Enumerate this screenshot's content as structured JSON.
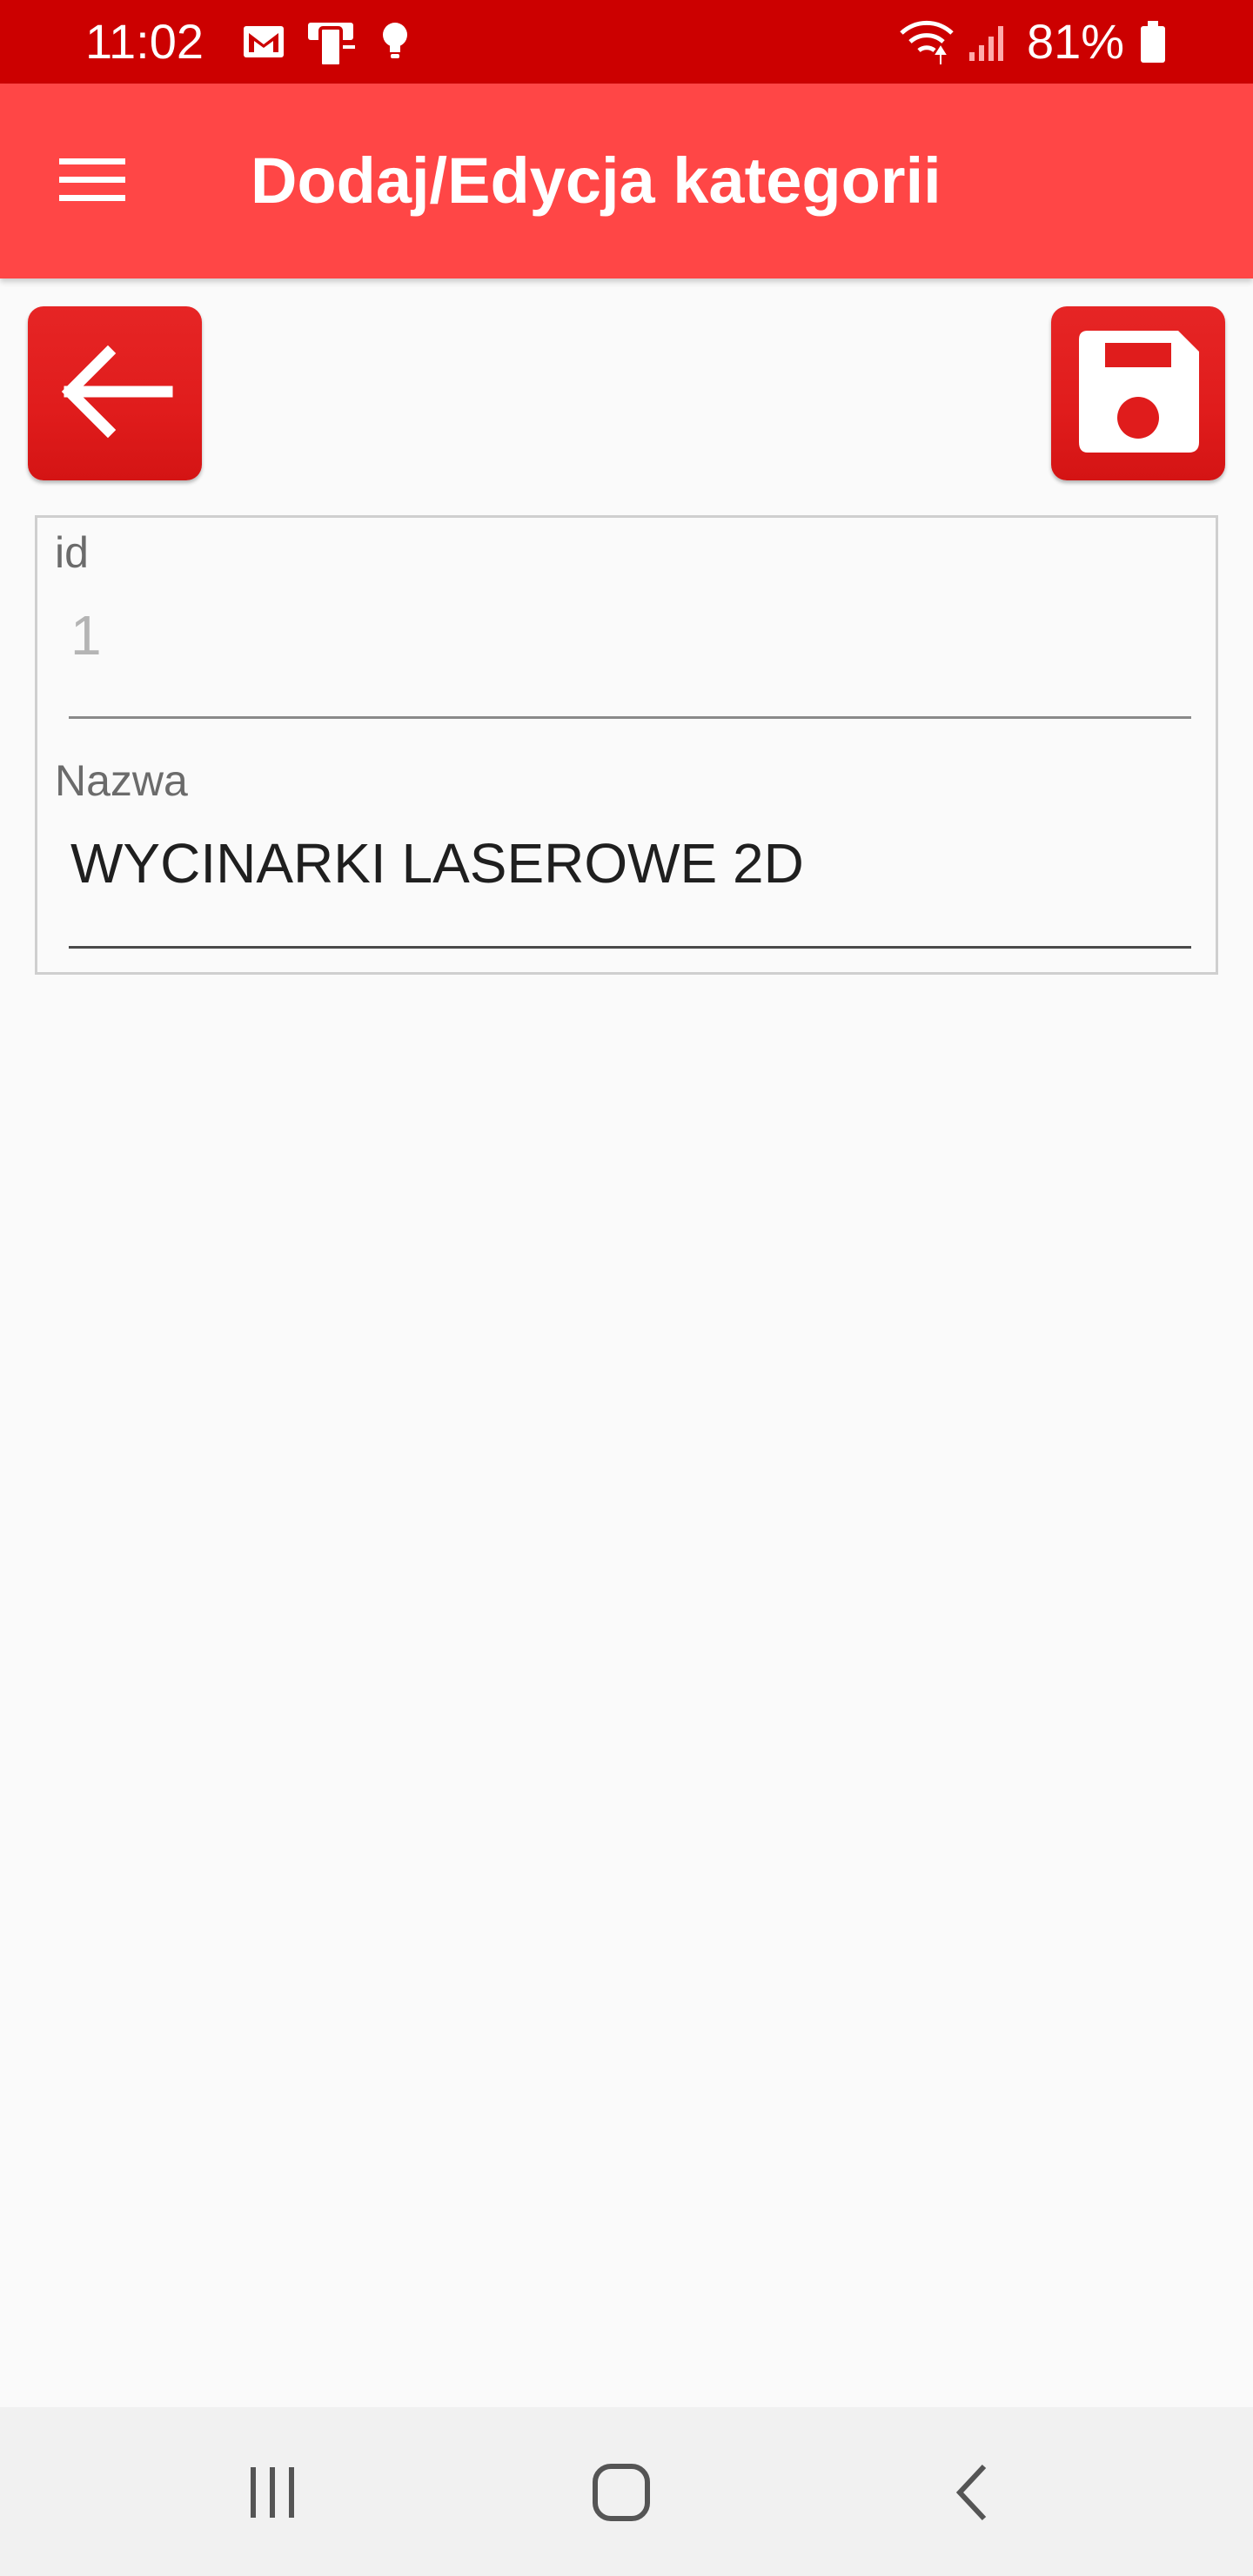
{
  "status_bar": {
    "time": "11:02",
    "battery_percent": "81%",
    "icons": [
      "gmail-icon",
      "device-transfer-icon",
      "lightbulb-icon",
      "wifi-icon",
      "signal-icon",
      "battery-icon"
    ],
    "background": "#cc0000"
  },
  "app_bar": {
    "title": "Dodaj/Edycja kategorii",
    "menu_icon": "hamburger-menu-icon",
    "background": "#ff4646"
  },
  "actions": {
    "back_icon": "arrow-left-icon",
    "save_icon": "floppy-disk-icon",
    "accent": "#e01c1c"
  },
  "form": {
    "id_label": "id",
    "id_value": "1",
    "name_label": "Nazwa",
    "name_value": "WYCINARKI LASEROWE 2D"
  },
  "nav_bar": {
    "recent_icon": "recent-apps-icon",
    "home_icon": "home-icon",
    "back_icon": "nav-back-icon"
  }
}
